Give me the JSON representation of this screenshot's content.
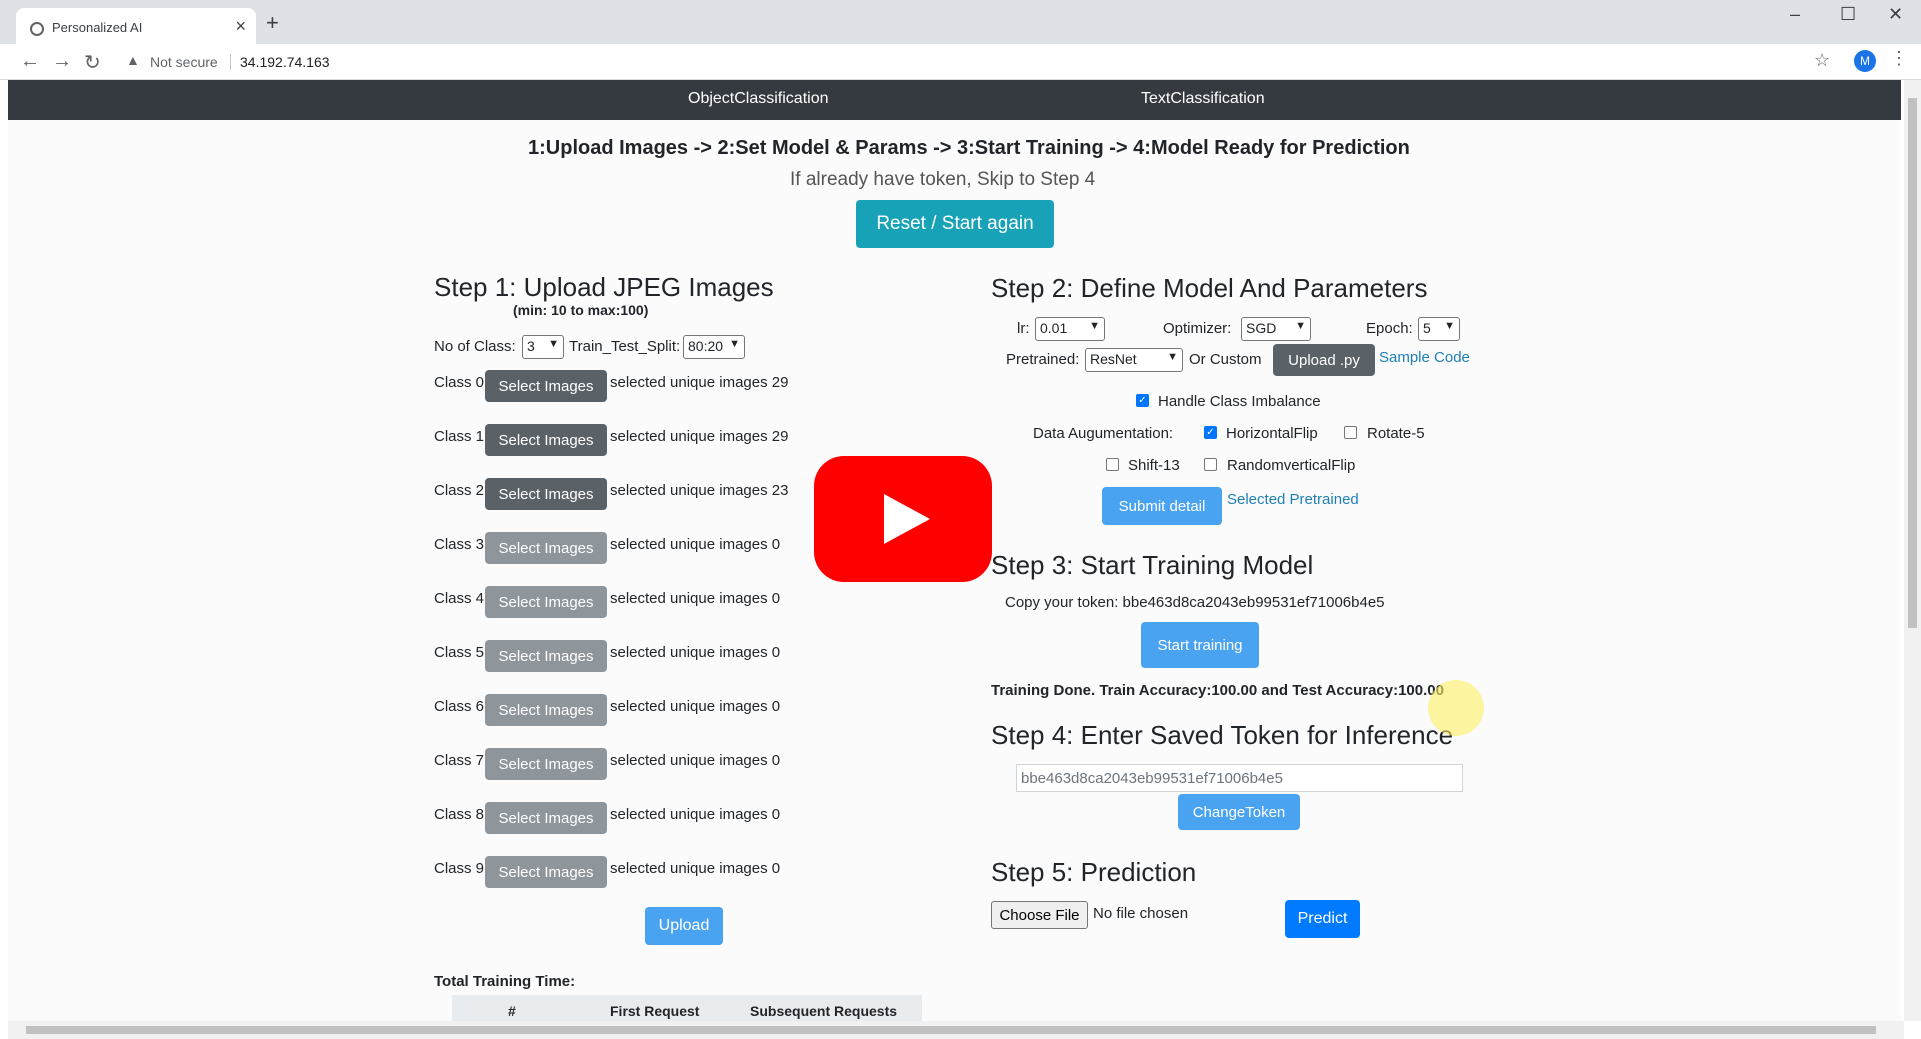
{
  "browser": {
    "tab_title": "Personalized AI",
    "security_label": "Not secure",
    "url": "34.192.74.163",
    "avatar_letter": "M"
  },
  "nav": {
    "object_classification": "ObjectClassification",
    "text_classification": "TextClassification"
  },
  "header": {
    "steps_flow": "1:Upload Images -> 2:Set Model & Params -> 3:Start Training -> 4:Model Ready for Prediction",
    "skip_note": "If already have token, Skip to Step 4",
    "reset_button": "Reset / Start again"
  },
  "step1": {
    "title": "Step 1: Upload JPEG Images",
    "subtitle": "(min: 10 to max:100)",
    "no_of_class_label": "No of Class:",
    "no_of_class_value": "3",
    "split_label": "Train_Test_Split:",
    "split_value": "80:20",
    "classes": [
      {
        "label": "Class 0:",
        "button": "Select Images",
        "status": "selected unique images 29"
      },
      {
        "label": "Class 1:",
        "button": "Select Images",
        "status": "selected unique images 29"
      },
      {
        "label": "Class 2:",
        "button": "Select Images",
        "status": "selected unique images 23"
      },
      {
        "label": "Class 3:",
        "button": "Select Images",
        "status": "selected unique images 0"
      },
      {
        "label": "Class 4:",
        "button": "Select Images",
        "status": "selected unique images 0"
      },
      {
        "label": "Class 5:",
        "button": "Select Images",
        "status": "selected unique images 0"
      },
      {
        "label": "Class 6:",
        "button": "Select Images",
        "status": "selected unique images 0"
      },
      {
        "label": "Class 7:",
        "button": "Select Images",
        "status": "selected unique images 0"
      },
      {
        "label": "Class 8:",
        "button": "Select Images",
        "status": "selected unique images 0"
      },
      {
        "label": "Class 9:",
        "button": "Select Images",
        "status": "selected unique images 0"
      }
    ],
    "upload_button": "Upload",
    "total_time_label": "Total Training Time:",
    "table_headers": [
      "#",
      "First Request",
      "Subsequent Requests"
    ]
  },
  "step2": {
    "title": "Step 2: Define Model And Parameters",
    "lr_label": "lr:",
    "lr_value": "0.01",
    "optimizer_label": "Optimizer:",
    "optimizer_value": "SGD",
    "epoch_label": "Epoch:",
    "epoch_value": "5",
    "pretrained_label": "Pretrained:",
    "pretrained_value": "ResNet",
    "or_custom": "Or Custom",
    "upload_py_button": "Upload .py",
    "sample_code_link": "Sample Code",
    "imbalance_label": "Handle Class Imbalance",
    "imbalance_checked": true,
    "augmentation_label": "Data Augumentation:",
    "aug_options": [
      {
        "label": "HorizontalFlip",
        "checked": true
      },
      {
        "label": "Rotate-5",
        "checked": false
      },
      {
        "label": "Shift-13",
        "checked": false
      },
      {
        "label": "RandomverticalFlip",
        "checked": false
      }
    ],
    "submit_button": "Submit detail",
    "selected_pretrained_link": "Selected Pretrained"
  },
  "step3": {
    "title": "Step 3: Start Training Model",
    "token_text": "Copy your token: bbe463d8ca2043eb99531ef71006b4e5",
    "start_button": "Start training",
    "result_text": "Training Done. Train Accuracy:100.00 and Test Accuracy:100.00"
  },
  "step4": {
    "title": "Step 4: Enter Saved Token for Inference",
    "token_input_value": "bbe463d8ca2043eb99531ef71006b4e5",
    "change_button": "ChangeToken"
  },
  "step5": {
    "title": "Step 5: Prediction",
    "choose_file_button": "Choose File",
    "no_file_text": "No file chosen",
    "predict_button": "Predict"
  },
  "colors": {
    "nav_bg": "#343a40",
    "success_green": "#198010",
    "info_button": "#17a2b8",
    "primary_button": "#007bff",
    "youtube_red": "#ff0000"
  }
}
